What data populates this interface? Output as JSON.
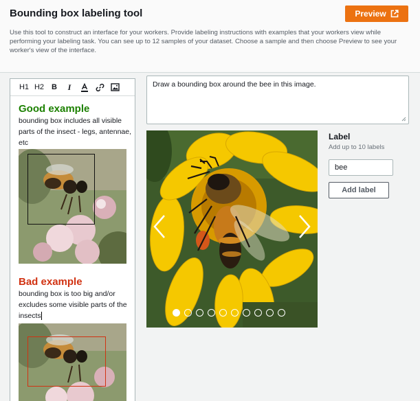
{
  "header": {
    "title": "Bounding box labeling tool",
    "preview_label": "Preview",
    "description": "Use this tool to construct an interface for your workers. Provide labeling instructions with examples that your workers view while performing your labeling task. You can see up to 12 samples of your dataset. Choose a sample and then choose Preview to see your worker's view of the interface."
  },
  "toolbar": {
    "h1": "H1",
    "h2": "H2",
    "bold": "B",
    "italic": "I"
  },
  "instructions": {
    "good_heading": "Good example",
    "good_text": "bounding box includes all visible parts of the insect - legs, antennae, etc",
    "bad_heading": "Bad example",
    "bad_text": "bounding box is too big and/or excludes some visible parts of the insects"
  },
  "prompt": {
    "text": "Draw a bounding box around the bee in this image."
  },
  "carousel": {
    "slide_count": 10,
    "active_index": 0
  },
  "labels": {
    "title": "Label",
    "hint": "Add up to 10 labels",
    "input_value": "bee",
    "add_button": "Add label"
  },
  "colors": {
    "accent": "#ec7211",
    "good": "#1d8102",
    "bad": "#d13212"
  }
}
